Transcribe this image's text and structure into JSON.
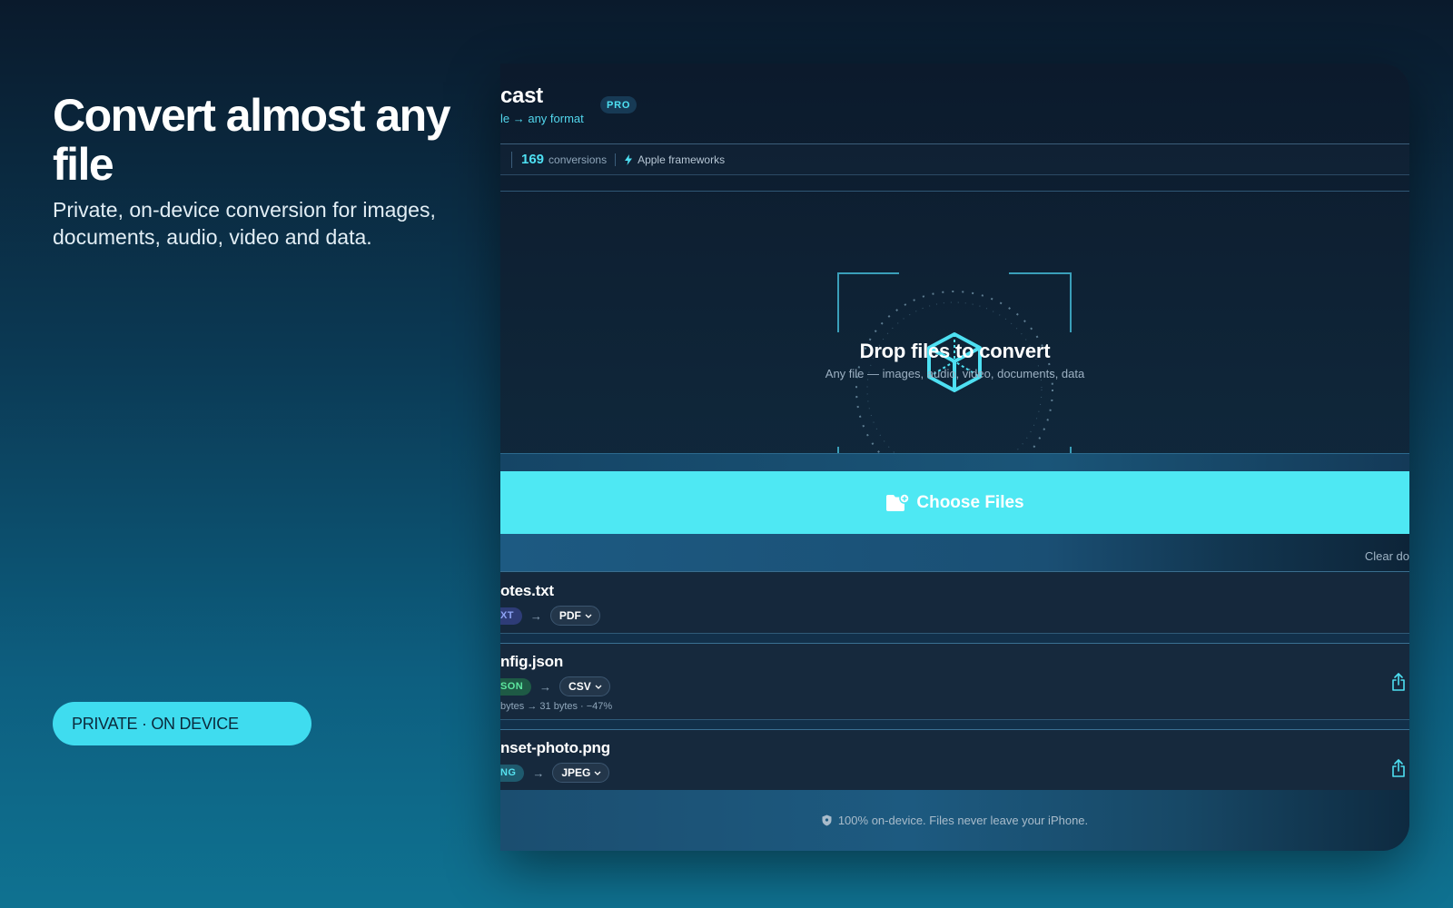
{
  "marketing": {
    "headline": "Convert almost any file",
    "subhead": "Private, on-device conversion for images, documents, audio, video and data.",
    "pill_label": "PRIVATE · ON DEVICE"
  },
  "app": {
    "title": "cast",
    "subtitle": "le → any format",
    "badge": "PRO",
    "stats": {
      "count": "169",
      "count_label": "conversions",
      "framework_label": "Apple frameworks"
    },
    "dropzone": {
      "title": "Drop files to convert",
      "hint": "Any file — images, audio, video, documents, data"
    },
    "choose_button": "Choose Files",
    "clear_label": "Clear do",
    "files": [
      {
        "name": "otes.txt",
        "source_format": "XT",
        "target_format": "PDF",
        "size_info": ""
      },
      {
        "name": "nfig.json",
        "source_format": "SON",
        "target_format": "CSV",
        "size_info": "bytes → 31 bytes · −47%"
      },
      {
        "name": "nset-photo.png",
        "source_format": "NG",
        "target_format": "JPEG",
        "size_info": ""
      }
    ],
    "footer": "100% on-device. Files never leave your iPhone."
  },
  "colors": {
    "accent": "#4ee8f3",
    "pill": "#3fdcef",
    "txt_badge": "#8ea3f4",
    "json_badge": "#5de69f",
    "png_badge": "#55e1ef"
  },
  "icons": [
    "bolt-icon",
    "cube-icon",
    "folder-plus-icon",
    "share-icon",
    "chevron-down-icon",
    "shield-icon"
  ]
}
